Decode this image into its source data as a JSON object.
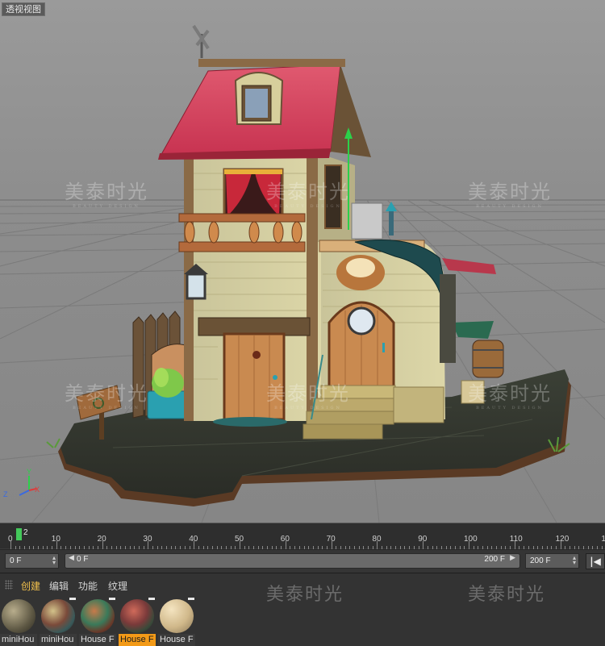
{
  "viewport": {
    "title": "透视视图",
    "watermark": "美泰时光",
    "watermark_sub": "BEAUTY DESIGN"
  },
  "timeline": {
    "current_frame": "2",
    "start_label": "0",
    "ticks": [
      "10",
      "20",
      "30",
      "40",
      "50",
      "60",
      "70",
      "80",
      "90",
      "100",
      "110",
      "120",
      "13"
    ]
  },
  "range": {
    "start_field": "0 F",
    "slider_start": "0 F",
    "slider_end": "200 F",
    "end_field": "200 F"
  },
  "material_manager": {
    "menu": [
      "创建",
      "编辑",
      "功能",
      "纹理"
    ],
    "materials": [
      {
        "name": "miniHou",
        "icon": "material-ball-stone-icon",
        "selected": false
      },
      {
        "name": "miniHou",
        "icon": "material-ball-house-icon",
        "selected": false
      },
      {
        "name": "House F",
        "icon": "material-ball-house-icon",
        "selected": false
      },
      {
        "name": "House F",
        "icon": "material-ball-house-icon",
        "selected": true
      },
      {
        "name": "House F",
        "icon": "material-ball-beige-icon",
        "selected": false
      }
    ]
  },
  "colors": {
    "accent_selected": "#f39a17",
    "playhead": "#43c85a",
    "menu_active": "#f2c04c"
  }
}
